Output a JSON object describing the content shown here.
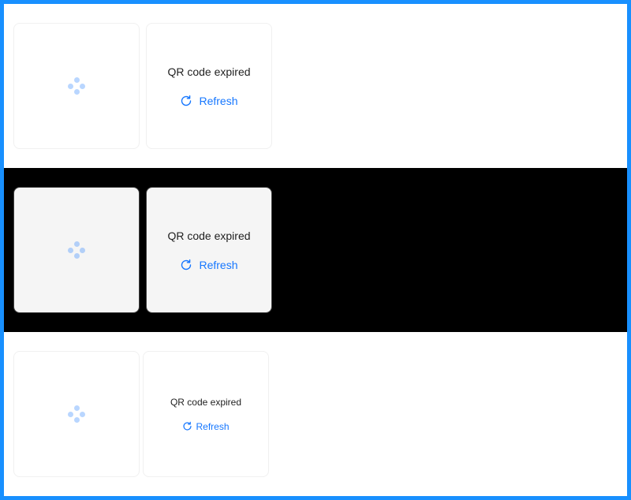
{
  "rows": [
    {
      "theme": "light",
      "expired_text": "QR code expired",
      "refresh_label": "Refresh"
    },
    {
      "theme": "dark",
      "expired_text": "QR code expired",
      "refresh_label": "Refresh"
    },
    {
      "theme": "light-small",
      "expired_text": "QR code expired",
      "refresh_label": "Refresh"
    }
  ],
  "colors": {
    "border_accent": "#1890ff",
    "link": "#1677ff",
    "dark_band": "#000000"
  },
  "icons": {
    "loading": "loading-dots-icon",
    "refresh": "refresh-icon"
  }
}
